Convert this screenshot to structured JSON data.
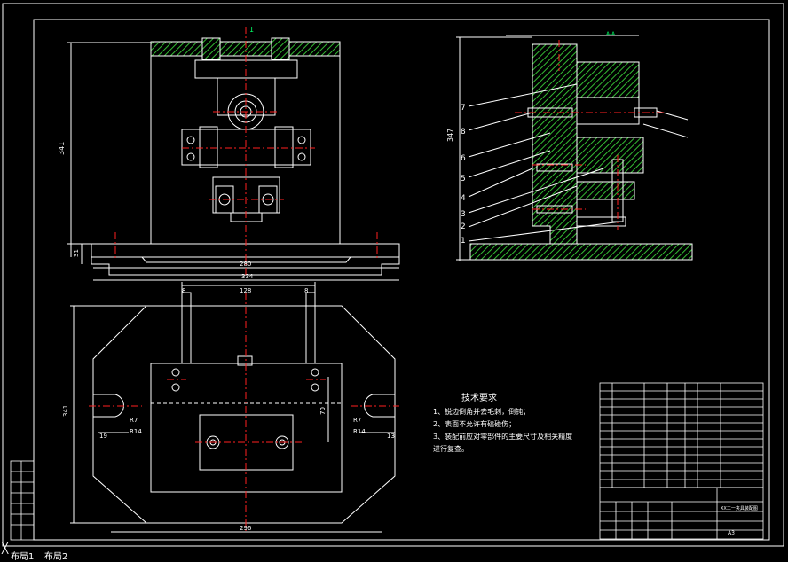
{
  "colors": {
    "background": "#000000",
    "outline": "#ffffff",
    "centerline": "#ff2020",
    "hatch": "#33bb33",
    "marker": "#00ff66",
    "dimension": "#ffffff"
  },
  "front_view": {
    "dim_height": "341",
    "dim_base_height": "31",
    "dim_width_inner": "280",
    "dim_width_outer": "334",
    "label_top": "1"
  },
  "side_view": {
    "dim_height": "347",
    "leader_numbers": [
      "7",
      "8",
      "6",
      "5",
      "4",
      "3",
      "2",
      "1"
    ],
    "section_label": "A-A"
  },
  "top_view": {
    "dim_128": "128",
    "dim_8_left": "8",
    "dim_8_right": "8",
    "dim_height": "341",
    "dim_70": "70",
    "dim_19_left": "19",
    "dim_13_right": "13",
    "r_left_small": "R7",
    "r_left_large": "R14",
    "r_right_small": "R7",
    "r_right_large": "R14",
    "dim_bottom": "296"
  },
  "tech_requirements": {
    "title": "技术要求",
    "items": [
      "1、锐边倒角并去毛刺，倒钝；",
      "2、表面不允许有磕碰伤；",
      "3、装配前应对零部件的主要尺寸及相关精度",
      "进行复查。"
    ]
  },
  "title_block": {
    "drawing_name": "XX工一夹具装配图",
    "scale": "A3"
  },
  "layout_tabs": [
    "布局1",
    "布局2"
  ]
}
